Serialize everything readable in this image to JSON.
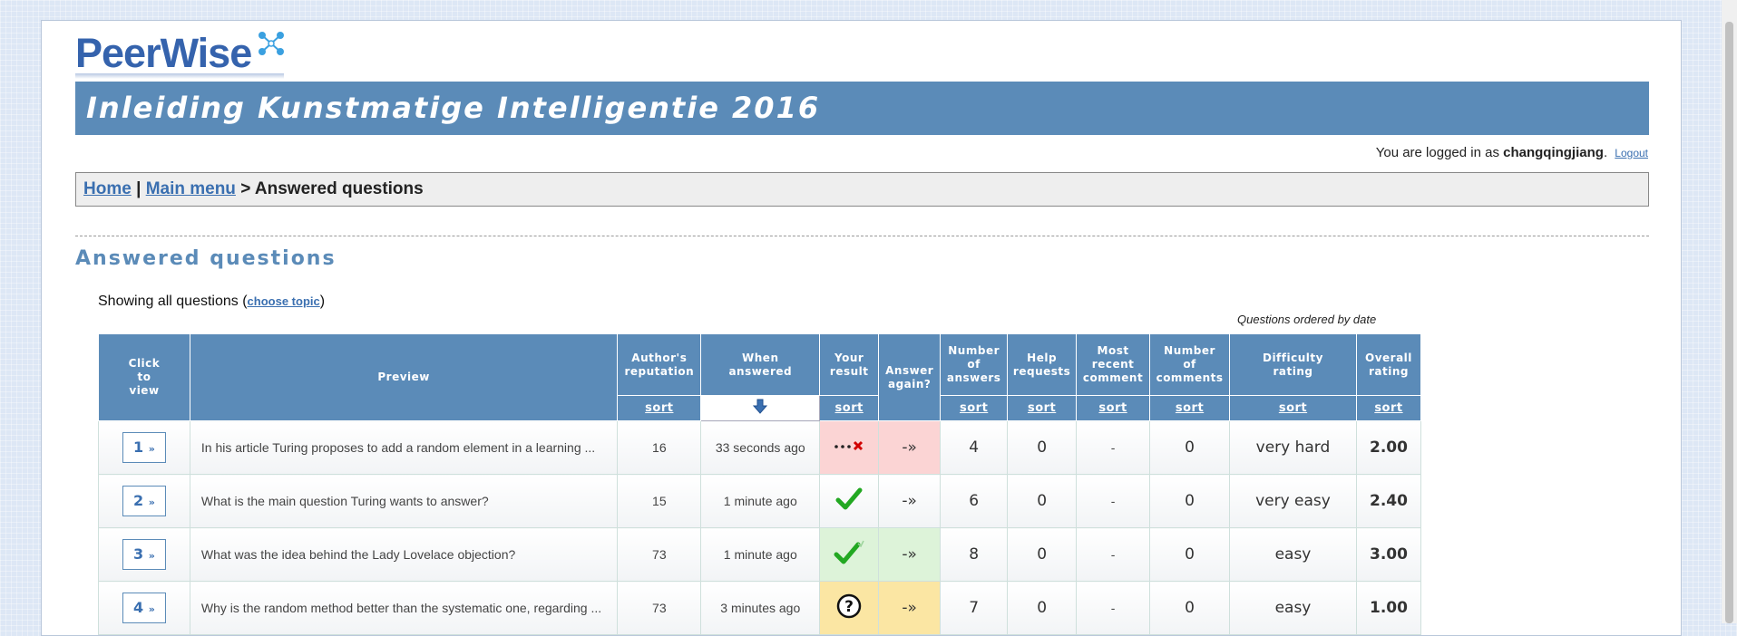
{
  "logo": {
    "text": "PeerWise"
  },
  "course_title": "Inleiding Kunstmatige Intelligentie 2016",
  "login": {
    "prefix": "You are logged in as ",
    "username": "changqingjiang",
    "suffix": ".",
    "logout_label": "Logout"
  },
  "breadcrumb": {
    "home": "Home",
    "sep1": "|",
    "main_menu": "Main menu",
    "sep2": ">",
    "current": "Answered questions"
  },
  "section_title": "Answered questions",
  "showing": {
    "prefix": "Showing all questions (",
    "link": "choose topic",
    "suffix": ")"
  },
  "ordered_by": "Questions ordered by date",
  "sort_label": "sort",
  "headers": {
    "click": [
      "Click",
      "to",
      "view"
    ],
    "preview": "Preview",
    "reputation": [
      "Author's",
      "reputation"
    ],
    "when": [
      "When",
      "answered"
    ],
    "result": [
      "Your",
      "result"
    ],
    "again": [
      "Answer",
      "again?"
    ],
    "answers": [
      "Number",
      "of",
      "answers"
    ],
    "help": [
      "Help",
      "requests"
    ],
    "recent": [
      "Most",
      "recent",
      "comment"
    ],
    "comments": [
      "Number",
      "of",
      "comments"
    ],
    "difficulty": [
      "Difficulty",
      "rating"
    ],
    "overall": [
      "Overall",
      "rating"
    ]
  },
  "rows": [
    {
      "num": "1",
      "preview": "In his article Turing proposes to add a random element in a learning ...",
      "reputation": "16",
      "when": "33 seconds ago",
      "result": "wrong",
      "answers": "4",
      "help": "0",
      "recent": "-",
      "comments": "0",
      "difficulty": "very hard",
      "overall": "2.00"
    },
    {
      "num": "2",
      "preview": "What is the main question Turing wants to answer?",
      "reputation": "15",
      "when": "1 minute ago",
      "result": "correct",
      "answers": "6",
      "help": "0",
      "recent": "-",
      "comments": "0",
      "difficulty": "very easy",
      "overall": "2.40"
    },
    {
      "num": "3",
      "preview": "What was the idea behind the Lady Lovelace objection?",
      "reputation": "73",
      "when": "1 minute ago",
      "result": "correct",
      "answers": "8",
      "help": "0",
      "recent": "-",
      "comments": "0",
      "difficulty": "easy",
      "overall": "3.00"
    },
    {
      "num": "4",
      "preview": "Why is the random method better than the systematic one, regarding ...",
      "reputation": "73",
      "when": "3 minutes ago",
      "result": "unknown",
      "answers": "7",
      "help": "0",
      "recent": "-",
      "comments": "0",
      "difficulty": "easy",
      "overall": "1.00"
    }
  ],
  "again_glyph": "-»",
  "btn_arrow": "»",
  "colors": {
    "banner": "#5b8bb8",
    "link": "#3a6fb0",
    "wrong_bg": "#fbd4d4",
    "right_bg": "#ddf3d9",
    "unknown_bg": "#fbe6a3"
  }
}
